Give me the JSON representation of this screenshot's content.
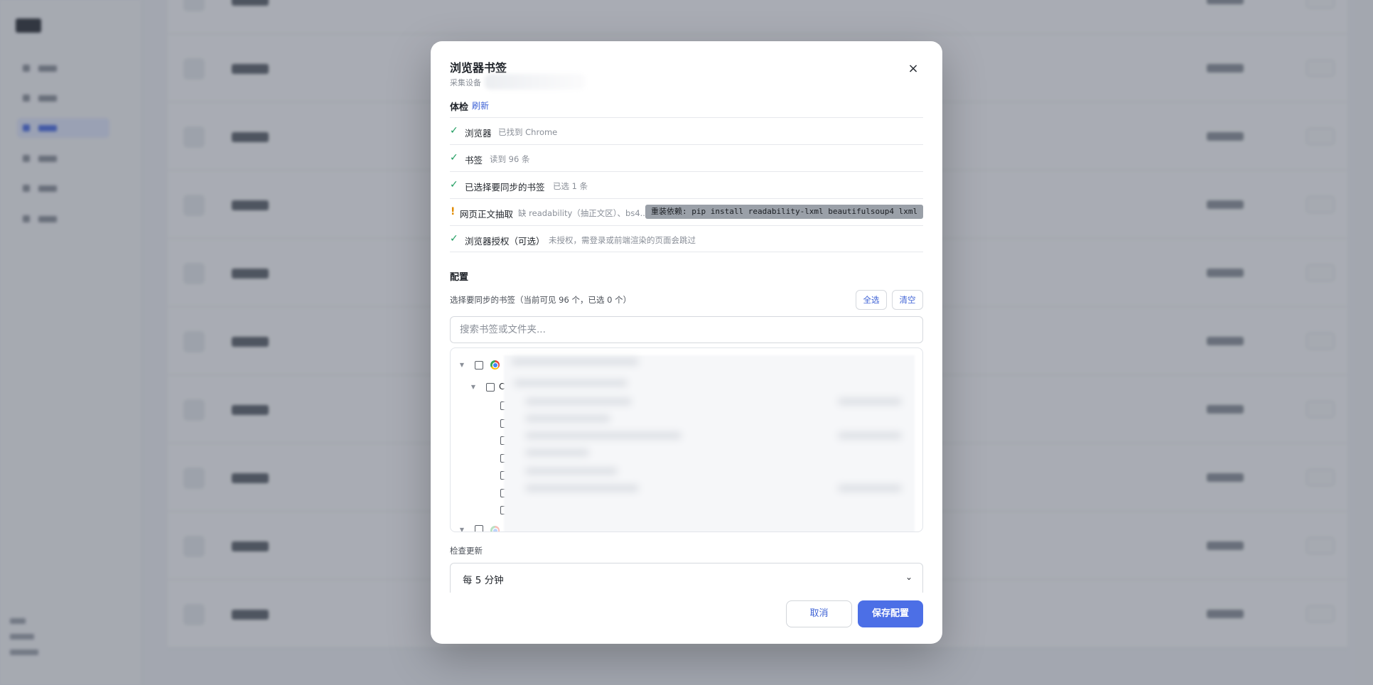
{
  "dialog": {
    "title": "浏览器书签",
    "subtitle": "采集设备",
    "close_icon": "×"
  },
  "health": {
    "title": "体检",
    "refresh": "刷新",
    "items": [
      {
        "status": "ok",
        "mark": "✓",
        "label": "浏览器",
        "detail": "已找到 Chrome"
      },
      {
        "status": "ok",
        "mark": "✓",
        "label": "书签",
        "detail": "读到 96 条"
      },
      {
        "status": "ok",
        "mark": "✓",
        "label": "已选择要同步的书签",
        "detail": "已选 1 条"
      },
      {
        "status": "warn",
        "mark": "!",
        "label": "网页正文抽取",
        "detail": "缺 readability（抽正文区）、bs4...",
        "action": "重装依赖: pip install readability-lxml beautifulsoup4 lxml"
      },
      {
        "status": "ok",
        "mark": "✓",
        "label": "浏览器授权（可选）",
        "detail": "未授权，需登录或前端渲染的页面会跳过"
      }
    ]
  },
  "config": {
    "title": "配置",
    "pick_label": "选择要同步的书签（当前可见 96 个，已选 0 个）",
    "select_all": "全选",
    "clear": "清空",
    "search_placeholder": "搜索书签或文件夹...",
    "tree_visible_text": "C",
    "update_label": "检查更新",
    "update_value": "每 5 分钟",
    "caret": "⌄"
  },
  "footer": {
    "cancel": "取消",
    "save": "保存配置"
  },
  "colors": {
    "primary": "#4c6fe6",
    "link": "#3f63d6",
    "ok": "#1f9d60",
    "warn": "#e08a00"
  }
}
